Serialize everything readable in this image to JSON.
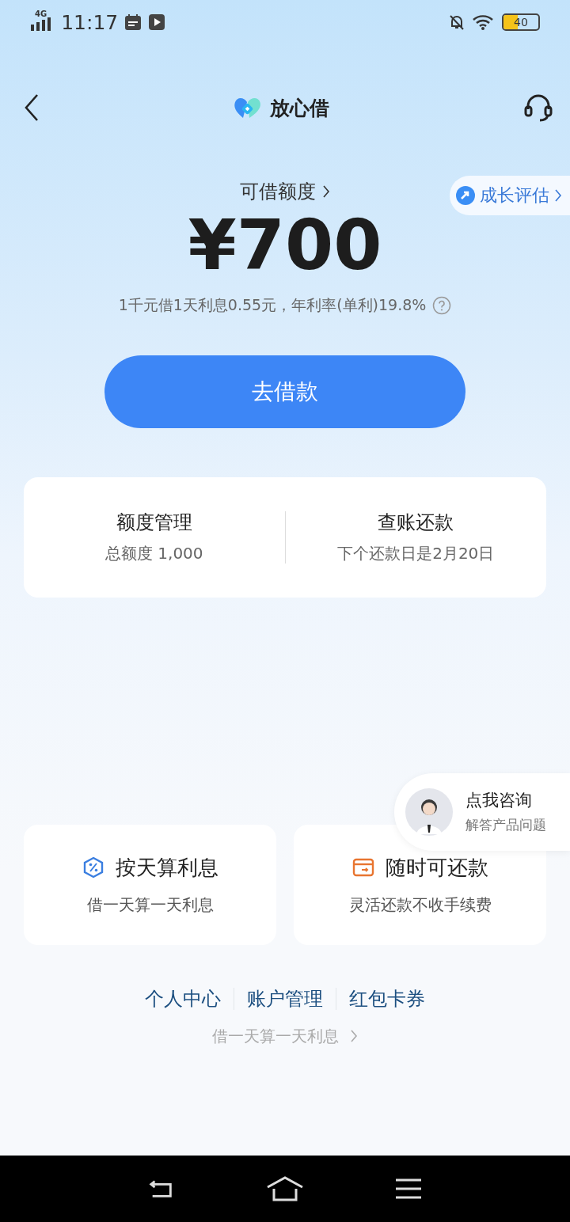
{
  "status_bar": {
    "network": "4G",
    "time": "11:17",
    "battery": "40"
  },
  "header": {
    "title": "放心借"
  },
  "growth_badge": {
    "label": "成长评估"
  },
  "credit": {
    "label": "可借额度",
    "amount": "¥700",
    "rate_note": "1千元借1天利息0.55元，年利率(单利)19.8%"
  },
  "borrow_button": {
    "label": "去借款"
  },
  "quick_cards": [
    {
      "title": "额度管理",
      "subtitle": "总额度 1,000"
    },
    {
      "title": "查账还款",
      "subtitle": "下个还款日是2月20日"
    }
  ],
  "consult": {
    "title": "点我咨询",
    "subtitle": "解答产品问题"
  },
  "features": [
    {
      "kind": "percent",
      "title": "按天算利息",
      "subtitle": "借一天算一天利息"
    },
    {
      "kind": "repay",
      "title": "随时可还款",
      "subtitle": "灵活还款不收手续费"
    }
  ],
  "footer_links": [
    "个人中心",
    "账户管理",
    "红包卡券"
  ],
  "footer_note": "借一天算一天利息"
}
